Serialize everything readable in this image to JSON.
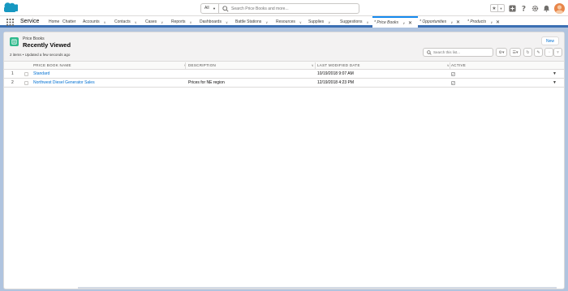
{
  "header": {
    "search_scope": "All",
    "search_placeholder": "Search Price Books and more..."
  },
  "nav": {
    "app_name": "Service",
    "items": [
      {
        "label": "Home",
        "chevron": false
      },
      {
        "label": "Chatter",
        "chevron": false
      },
      {
        "label": "Accounts",
        "chevron": true
      },
      {
        "label": "Contacts",
        "chevron": true
      },
      {
        "label": "Cases",
        "chevron": true
      },
      {
        "label": "Reports",
        "chevron": true
      },
      {
        "label": "Dashboards",
        "chevron": true
      },
      {
        "label": "Battle Stations",
        "chevron": true
      },
      {
        "label": "Resources",
        "chevron": true
      },
      {
        "label": "Supplies",
        "chevron": true
      },
      {
        "label": "Suggestions",
        "chevron": true
      }
    ],
    "tabs": [
      {
        "label": "* Price Books",
        "active": true
      },
      {
        "label": "* Opportunities",
        "active": false
      },
      {
        "label": "* Products",
        "active": false
      }
    ]
  },
  "list": {
    "object_type": "Price Books",
    "title": "Recently Viewed",
    "meta": "2 items • Updated a few seconds ago",
    "new_label": "New",
    "search_placeholder": "Search this list...",
    "columns": {
      "name": "Price Book Name",
      "description": "Description",
      "modified": "Last Modified Date",
      "active": "Active"
    },
    "rows": [
      {
        "num": "1",
        "name": "Standard",
        "description": "",
        "modified": "10/19/2018 9:07 AM",
        "active": true
      },
      {
        "num": "2",
        "name": "Northwest Diesel Generator Sales",
        "description": "Prices for NE region",
        "modified": "12/19/2018 4:23 PM",
        "active": true
      }
    ]
  },
  "colors": {
    "brand_blue": "#0070d2",
    "nav_bar": "#3b6fb3",
    "object_icon": "#30b98c",
    "background": "#b0c4df"
  }
}
